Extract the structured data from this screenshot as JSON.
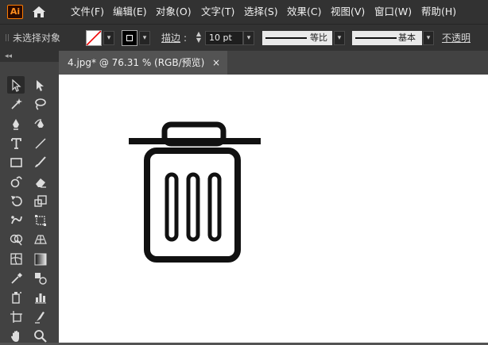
{
  "app": {
    "logo_text": "Ai"
  },
  "menu": [
    "文件(F)",
    "编辑(E)",
    "对象(O)",
    "文字(T)",
    "选择(S)",
    "效果(C)",
    "视图(V)",
    "窗口(W)",
    "帮助(H)"
  ],
  "control_bar": {
    "selection_status": "未选择对象",
    "stroke_label": "描边",
    "stroke_weight": "10 pt",
    "profile_label": "等比",
    "brush_label": "基本",
    "opacity_label": "不透明度："
  },
  "document_tab": {
    "title": "4.jpg* @ 76.31 % (RGB/预览)",
    "close": "×"
  },
  "colors": {
    "menubar": "#323232",
    "panel": "#424242",
    "workspace": "#535353",
    "canvas": "#ffffff",
    "logo_accent": "#ff7c00"
  },
  "tools": [
    "selection-tool",
    "direct-selection-tool",
    "magic-wand-tool",
    "lasso-tool",
    "pen-tool",
    "curvature-tool",
    "type-tool",
    "line-segment-tool",
    "rectangle-tool",
    "paintbrush-tool",
    "shaper-tool",
    "eraser-tool",
    "rotate-tool",
    "scale-tool",
    "puppet-warp-tool",
    "free-transform-tool",
    "shape-builder-tool",
    "perspective-grid-tool",
    "mesh-tool",
    "gradient-tool",
    "eyedropper-tool",
    "blend-tool",
    "symbol-sprayer-tool",
    "column-graph-tool",
    "artboard-tool",
    "slice-tool",
    "hand-tool",
    "zoom-tool"
  ]
}
